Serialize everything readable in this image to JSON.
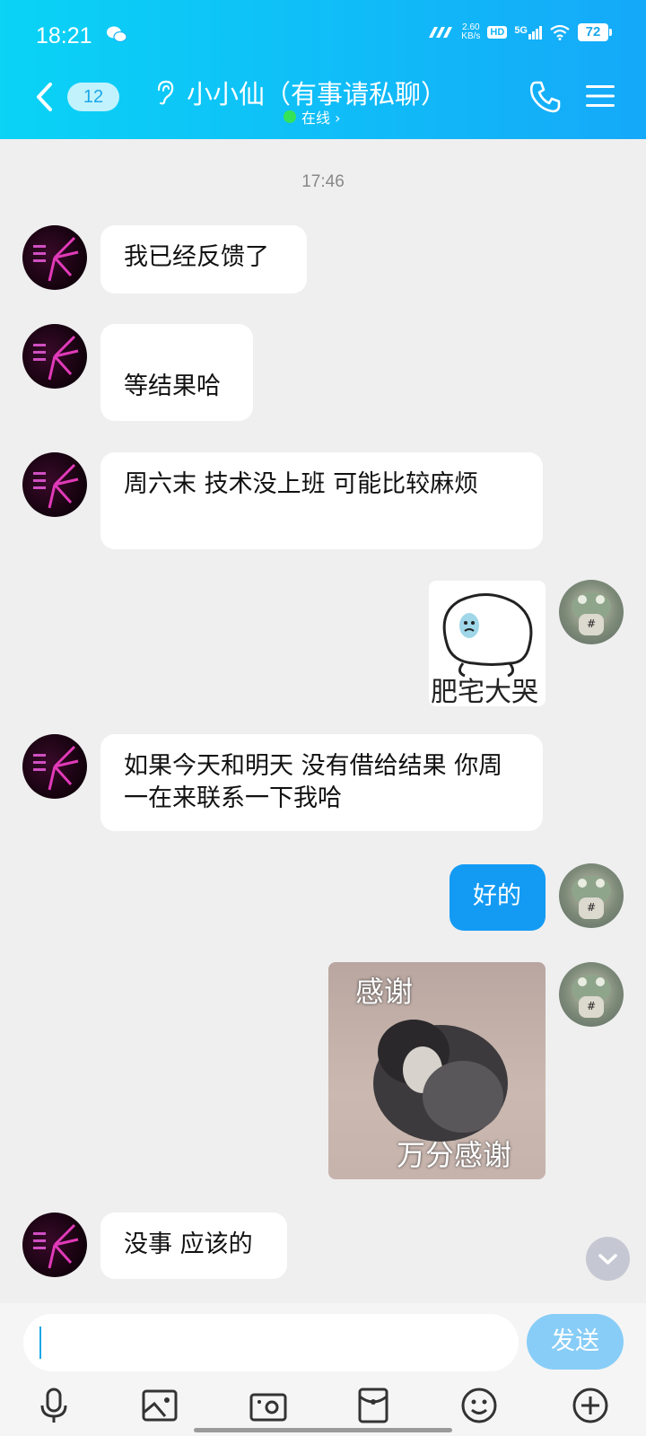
{
  "status_bar": {
    "time": "18:21",
    "net_speed_value": "2.60",
    "net_speed_unit": "KB/s",
    "hd_label": "HD",
    "network_label": "5G",
    "battery": "72"
  },
  "header": {
    "unread_count": "12",
    "title": "小小仙（有事请私聊）",
    "status": "在线 ›"
  },
  "chat": {
    "timestamp": "17:46",
    "messages": [
      {
        "sender": "other",
        "text": "我已经反馈了"
      },
      {
        "sender": "other",
        "text": "等结果哈"
      },
      {
        "sender": "other",
        "text": "周六末 技术没上班  可能比较麻烦"
      },
      {
        "sender": "me",
        "type": "sticker",
        "caption": "肥宅大哭"
      },
      {
        "sender": "other",
        "text": "如果今天和明天 没有借给结果 你周一在来联系一下我哈"
      },
      {
        "sender": "me",
        "text": "好的"
      },
      {
        "sender": "me",
        "type": "sticker",
        "caption_top": "感谢",
        "caption_bottom": "万分感谢"
      },
      {
        "sender": "other",
        "text": "没事 应该的"
      }
    ]
  },
  "input": {
    "value": "",
    "send_label": "发送"
  },
  "colors": {
    "header_start": "#0ad3f6",
    "header_end": "#15a9f9",
    "my_bubble": "#139bf4",
    "send_button": "#88cdf7",
    "online_dot": "#35e35a"
  }
}
